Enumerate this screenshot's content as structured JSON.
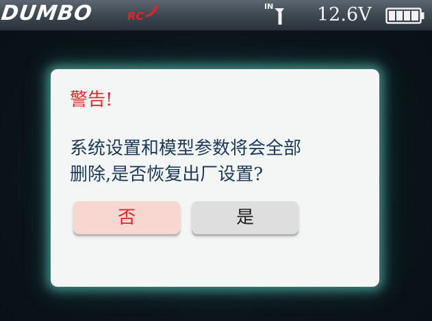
{
  "statusbar": {
    "logo_text": "DUMBO",
    "logo_suffix": "RC",
    "antenna_label": "IN",
    "antenna_icon": "antenna-icon",
    "voltage": "12.6V",
    "battery_icon": "battery-full-icon",
    "battery_level": 1.0
  },
  "dialog": {
    "title": "警告!",
    "message_line1": "系统设置和模型参数将会全部",
    "message_line2": "删除,是否恢复出厂设置?",
    "no_label": "否",
    "yes_label": "是"
  },
  "colors": {
    "warning_red": "#e3262a",
    "message_text": "#1d3a5a",
    "no_button_bg": "#f9d7d1",
    "yes_button_bg": "#dedede",
    "glow": "#5fc8be"
  }
}
